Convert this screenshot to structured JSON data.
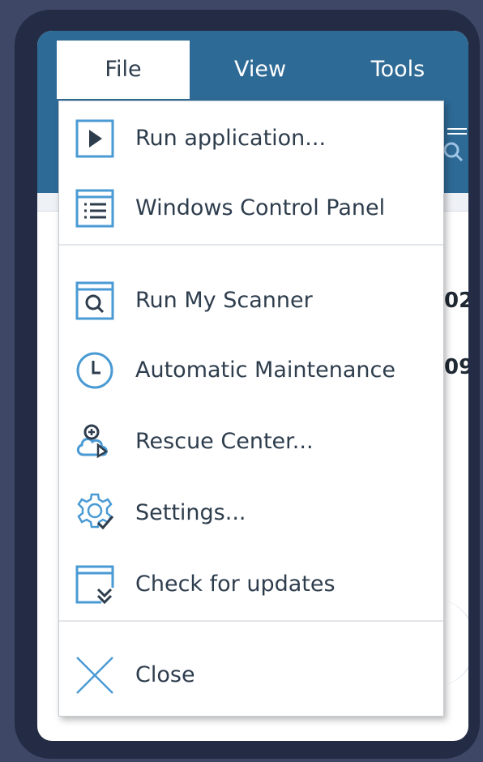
{
  "menubar": {
    "tabs": [
      {
        "label": "File",
        "active": true
      },
      {
        "label": "View",
        "active": false
      },
      {
        "label": "Tools",
        "active": false
      }
    ]
  },
  "background": {
    "values": [
      "02",
      "09"
    ]
  },
  "file_menu": {
    "items": [
      {
        "label": "Run application...",
        "icon": "play-window-icon"
      },
      {
        "label": "Windows Control Panel",
        "icon": "list-window-icon"
      },
      {
        "label": "Run My Scanner",
        "icon": "scanner-icon"
      },
      {
        "label": "Automatic Maintenance",
        "icon": "clock-icon"
      },
      {
        "label": "Rescue Center...",
        "icon": "rescue-cloud-icon"
      },
      {
        "label": "Settings...",
        "icon": "gear-check-icon"
      },
      {
        "label": "Check for updates",
        "icon": "update-window-icon"
      },
      {
        "label": "Close",
        "icon": "close-icon"
      }
    ]
  },
  "colors": {
    "menubar": "#2e6a96",
    "icon": "#4a9ad4",
    "text": "#2e3d4d",
    "frame": "#232c44",
    "backdrop": "#3e4866"
  }
}
